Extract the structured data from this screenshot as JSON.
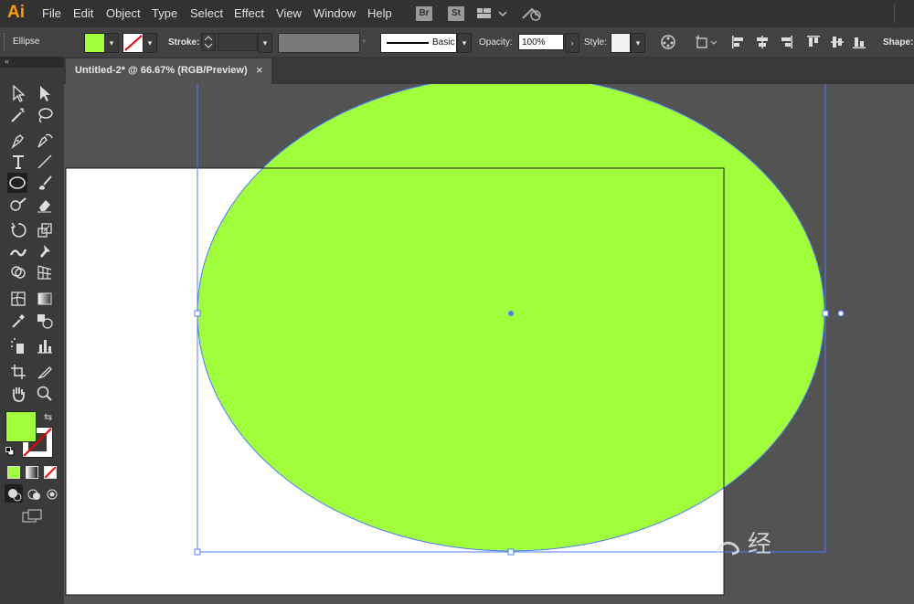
{
  "app": {
    "logo": "Ai"
  },
  "menu": [
    "File",
    "Edit",
    "Object",
    "Type",
    "Select",
    "Effect",
    "View",
    "Window",
    "Help"
  ],
  "menu_icons": {
    "bridge": "Br",
    "stock": "St"
  },
  "control_bar": {
    "selection_label": "Ellipse",
    "fill_color": "#a0ff3a",
    "stroke_label": "Stroke:",
    "brush_label": "Basic",
    "opacity_label": "Opacity:",
    "opacity_value": "100%",
    "style_label": "Style:",
    "shape_label": "Shape:"
  },
  "document_tab": {
    "title": "Untitled-2* @ 66.67% (RGB/Preview)",
    "close": "×"
  },
  "colors": {
    "ellipse_fill": "#a0ff3a",
    "selection": "#4a7cff",
    "artboard": "#ffffff",
    "canvas": "#535353",
    "accent": "#ff9a00"
  },
  "watermark": {
    "text": "经"
  }
}
